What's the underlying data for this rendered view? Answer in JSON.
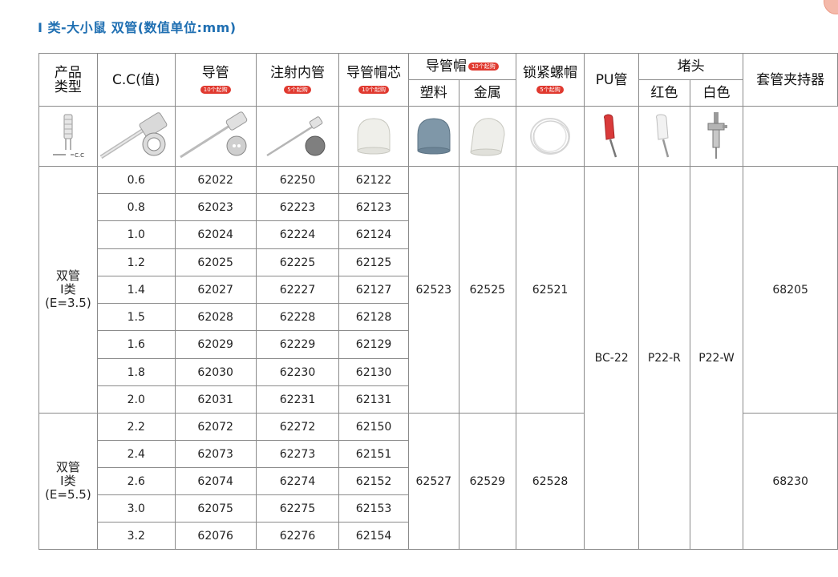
{
  "page": {
    "title": "I 类-大小鼠   双管(数值单位:mm)"
  },
  "headers": {
    "product_type": "产品类型",
    "cc": "C.C(值)",
    "guide_tube": "导管",
    "guide_tube_badge": "10个起购",
    "inner_tube": "注射内管",
    "inner_tube_badge": "5个起购",
    "cap_core": "导管帽芯",
    "cap_core_badge": "10个起购",
    "cap": "导管帽",
    "cap_badge": "10个起购",
    "cap_plastic": "塑料",
    "cap_metal": "金属",
    "lock_nut": "锁紧螺帽",
    "lock_nut_badge": "5个起购",
    "pu_tube": "PU管",
    "plug": "堵头",
    "plug_red": "红色",
    "plug_white": "白色",
    "holder": "套管夹持器"
  },
  "icon_labels": {
    "cc_mark": "C.C"
  },
  "groups": [
    {
      "name": "双管\nI类\n(E=3.5)",
      "cap_plastic": "62523",
      "cap_metal": "62525",
      "lock_nut": "62521",
      "holder": "68205",
      "rows": [
        {
          "cc": "0.6",
          "guide": "62022",
          "inner": "62250",
          "core": "62122"
        },
        {
          "cc": "0.8",
          "guide": "62023",
          "inner": "62223",
          "core": "62123"
        },
        {
          "cc": "1.0",
          "guide": "62024",
          "inner": "62224",
          "core": "62124"
        },
        {
          "cc": "1.2",
          "guide": "62025",
          "inner": "62225",
          "core": "62125"
        },
        {
          "cc": "1.4",
          "guide": "62027",
          "inner": "62227",
          "core": "62127"
        },
        {
          "cc": "1.5",
          "guide": "62028",
          "inner": "62228",
          "core": "62128"
        },
        {
          "cc": "1.6",
          "guide": "62029",
          "inner": "62229",
          "core": "62129"
        },
        {
          "cc": "1.8",
          "guide": "62030",
          "inner": "62230",
          "core": "62130"
        },
        {
          "cc": "2.0",
          "guide": "62031",
          "inner": "62231",
          "core": "62131"
        }
      ]
    },
    {
      "name": "双管\nI类\n(E=5.5)",
      "cap_plastic": "62527",
      "cap_metal": "62529",
      "lock_nut": "62528",
      "holder": "68230",
      "rows": [
        {
          "cc": "2.2",
          "guide": "62072",
          "inner": "62272",
          "core": "62150"
        },
        {
          "cc": "2.4",
          "guide": "62073",
          "inner": "62273",
          "core": "62151"
        },
        {
          "cc": "2.6",
          "guide": "62074",
          "inner": "62274",
          "core": "62152"
        },
        {
          "cc": "3.0",
          "guide": "62075",
          "inner": "62275",
          "core": "62153"
        },
        {
          "cc": "3.2",
          "guide": "62076",
          "inner": "62276",
          "core": "62154"
        }
      ]
    }
  ],
  "shared": {
    "pu_tube": "BC-22",
    "plug_red": "P22-R",
    "plug_white": "P22-W"
  },
  "colors": {
    "title": "#1f6fb2",
    "badge": "#e0392f",
    "border": "#8a8a8a"
  }
}
